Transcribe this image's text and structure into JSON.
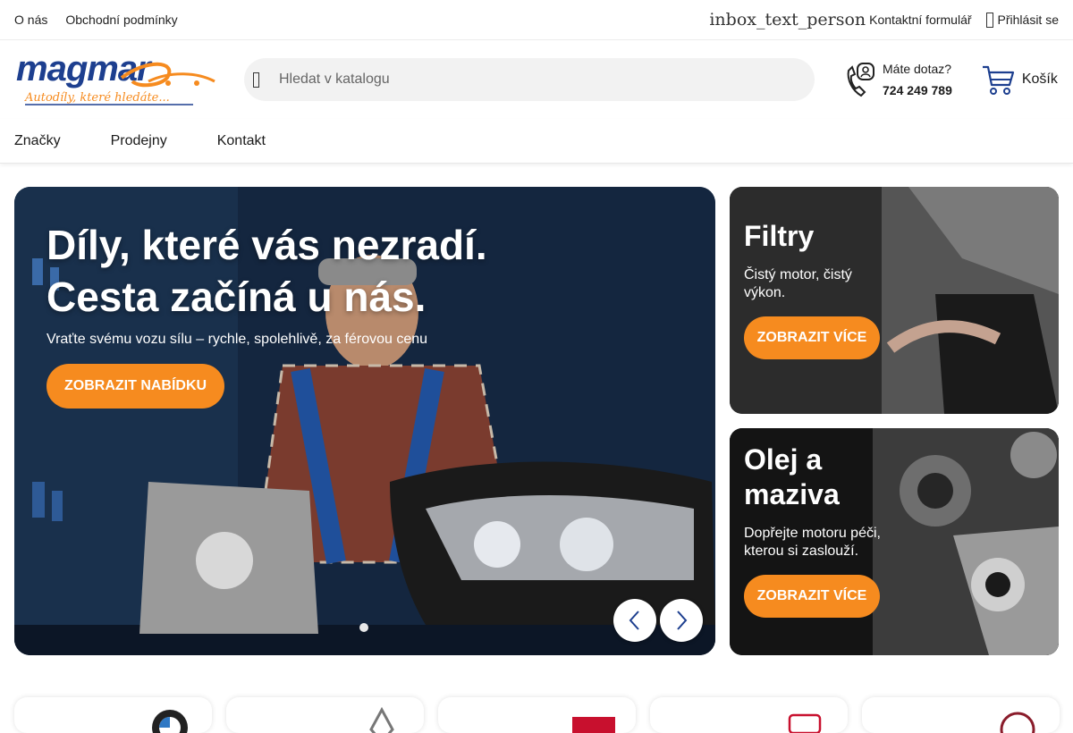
{
  "topbar": {
    "links": [
      "O nás",
      "Obchodní podmínky"
    ],
    "ligature_text": "inbox_text_person",
    "contact_form": "Kontaktní formulář",
    "login": "Přihlásit se"
  },
  "header": {
    "logo_text": "magmar",
    "logo_tagline": "Autodíly, které hledáte...",
    "search_placeholder": "Hledat v katalogu",
    "contact_question": "Máte dotaz?",
    "contact_phone": "724 249 789",
    "cart_label": "Košík"
  },
  "nav": {
    "items": [
      "Značky",
      "Prodejny",
      "Kontakt"
    ]
  },
  "hero": {
    "title_line1": "Díly, které vás nezradí.",
    "title_line2": "Cesta začíná u nás.",
    "subtitle": "Vraťte svému vozu sílu – rychle, spolehlivě, za férovou cenu",
    "button": "ZOBRAZIT NABÍDKU",
    "slide_index": 1
  },
  "cards": [
    {
      "title": "Filtry",
      "desc": "Čistý motor, čistý výkon.",
      "button": "ZOBRAZIT VÍCE"
    },
    {
      "title": "Olej a maziva",
      "desc": "Dopřejte motoru péči, kterou si zaslouží.",
      "button": "ZOBRAZIT VÍCE"
    }
  ],
  "colors": {
    "accent": "#f68b1f",
    "logo_blue": "#1d3f8f",
    "logo_orange": "#f68b1f"
  },
  "icons": [
    "search-icon",
    "phone-icon",
    "cart-icon",
    "chevron-left-icon",
    "chevron-right-icon",
    "user-icon"
  ]
}
